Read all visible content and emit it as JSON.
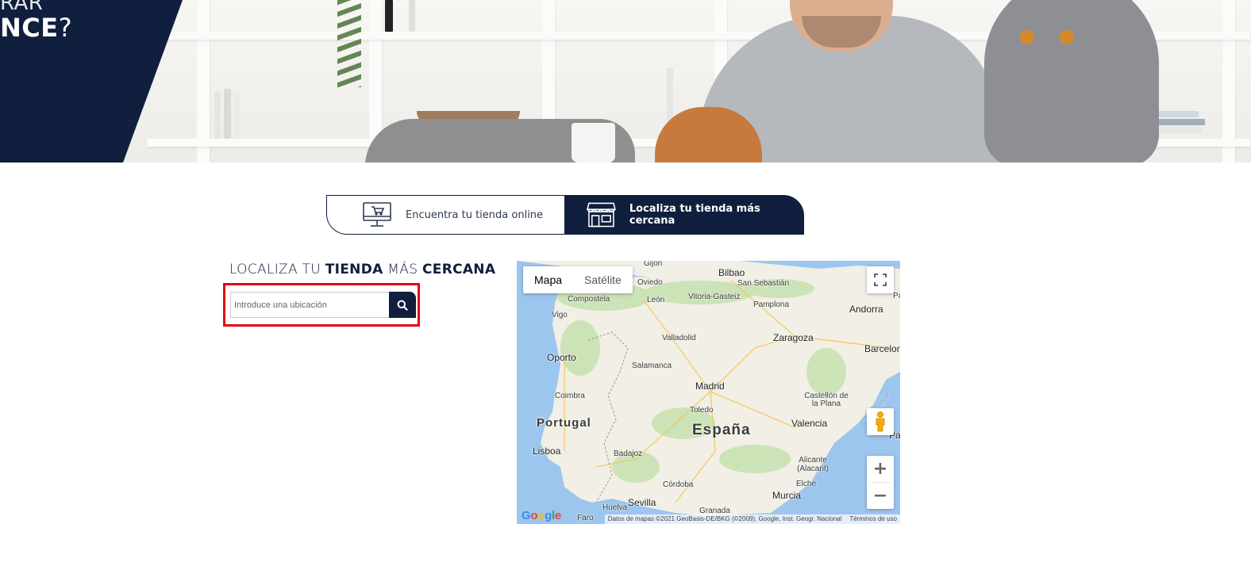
{
  "hero": {
    "slogan_regular": "",
    "slogan_bold": "NCE",
    "slogan_suffix": "?",
    "slogan_top_fragment": "RAR"
  },
  "tabs": [
    {
      "label": "Encuentra tu tienda online",
      "icon": "computer-cart-icon",
      "active": false
    },
    {
      "label": "Localiza tu tienda más cercana",
      "icon": "storefront-icon",
      "active": true
    }
  ],
  "locator": {
    "title_parts": [
      "LOCALIZA TU ",
      "TIENDA",
      " MÁS ",
      "CERCANA"
    ],
    "search_placeholder": "Introduce una ubicación",
    "search_icon": "search-icon",
    "highlight_color": "#e30613"
  },
  "map": {
    "type_buttons": [
      "Mapa",
      "Satélite"
    ],
    "active_type": "Mapa",
    "zoom_in": "+",
    "zoom_out": "−",
    "logo": "Google",
    "attribution": "Datos de mapas ©2021 GeoBasis-DE/BKG (©2009), Google, Inst. Geogr. Nacional",
    "terms": "Términos de uso",
    "cities": [
      "Gijón",
      "Bilbao",
      "San Sebastián",
      "Oviedo",
      "Compostela",
      "León",
      "Vitoria-Gasteiz",
      "Pamplona",
      "Andorra",
      "Vigo",
      "Valladolid",
      "Zaragoza",
      "Barcelona",
      "Oporto",
      "Salamanca",
      "Madrid",
      "Coimbra",
      "Castellón de la Plana",
      "Toledo",
      "Portugal",
      "España",
      "Valencia",
      "Lisboa",
      "Badajoz",
      "Alicante (Alacant)",
      "Elche",
      "Córdoba",
      "Murcia",
      "Sevilla",
      "Huelva",
      "Granada",
      "Faro",
      "Mar Balear",
      "Pa",
      "Pal"
    ]
  },
  "colors": {
    "navy": "#0f1f3d",
    "white": "#ffffff",
    "sea": "#9dc6ee",
    "land": "#f1efe6"
  }
}
